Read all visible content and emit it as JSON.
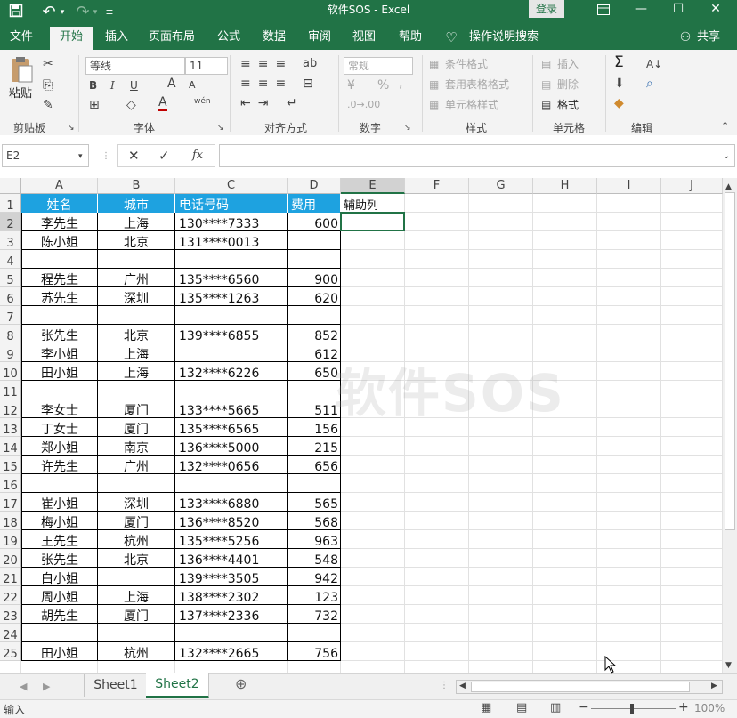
{
  "titlebar": {
    "title": "软件SOS  -  Excel",
    "login": "登录"
  },
  "tabs": [
    {
      "label": "文件"
    },
    {
      "label": "开始"
    },
    {
      "label": "插入"
    },
    {
      "label": "页面布局"
    },
    {
      "label": "公式"
    },
    {
      "label": "数据"
    },
    {
      "label": "审阅"
    },
    {
      "label": "视图"
    },
    {
      "label": "帮助"
    }
  ],
  "tellme": "操作说明搜索",
  "share": "共享",
  "ribbon": {
    "clipboard": {
      "paste": "粘贴",
      "label": "剪贴板"
    },
    "font": {
      "name": "等线",
      "size": "11",
      "label": "字体",
      "bold": "B",
      "italic": "I",
      "underline": "U",
      "grow": "A",
      "shrink": "A",
      "color_a": "A",
      "phonetic": "wén"
    },
    "alignment": {
      "label": "对齐方式"
    },
    "number": {
      "format": "常规",
      "label": "数字",
      "percent": "%",
      "comma": ","
    },
    "styles": {
      "cond": "条件格式",
      "table": "套用表格格式",
      "cell": "单元格样式",
      "label": "样式"
    },
    "cells": {
      "insert": "插入",
      "delete": "删除",
      "format": "格式",
      "label": "单元格"
    },
    "editing": {
      "label": "编辑"
    }
  },
  "formula": {
    "namebox": "E2",
    "value": "",
    "fx": "fx",
    "cancel": "✕",
    "enter": "✓"
  },
  "columns": [
    "A",
    "B",
    "C",
    "D",
    "E",
    "F",
    "G",
    "H",
    "I",
    "J"
  ],
  "headers": {
    "a": "姓名",
    "b": "城市",
    "c": "电话号码",
    "d": "费用",
    "e": "辅助列"
  },
  "rows": [
    {
      "n": "2",
      "a": "李先生",
      "b": "上海",
      "c": "130****7333",
      "d": "600"
    },
    {
      "n": "3",
      "a": "陈小姐",
      "b": "北京",
      "c": "131****0013",
      "d": ""
    },
    {
      "n": "4",
      "a": "",
      "b": "",
      "c": "",
      "d": ""
    },
    {
      "n": "5",
      "a": "程先生",
      "b": "广州",
      "c": "135****6560",
      "d": "900"
    },
    {
      "n": "6",
      "a": "苏先生",
      "b": "深圳",
      "c": "135****1263",
      "d": "620"
    },
    {
      "n": "7",
      "a": "",
      "b": "",
      "c": "",
      "d": ""
    },
    {
      "n": "8",
      "a": "张先生",
      "b": "北京",
      "c": "139****6855",
      "d": "852"
    },
    {
      "n": "9",
      "a": "李小姐",
      "b": "上海",
      "c": "",
      "d": "612"
    },
    {
      "n": "10",
      "a": "田小姐",
      "b": "上海",
      "c": "132****6226",
      "d": "650"
    },
    {
      "n": "11",
      "a": "",
      "b": "",
      "c": "",
      "d": ""
    },
    {
      "n": "12",
      "a": "李女士",
      "b": "厦门",
      "c": "133****5665",
      "d": "511"
    },
    {
      "n": "13",
      "a": "丁女士",
      "b": "厦门",
      "c": "135****6565",
      "d": "156"
    },
    {
      "n": "14",
      "a": "郑小姐",
      "b": "南京",
      "c": "136****5000",
      "d": "215"
    },
    {
      "n": "15",
      "a": "许先生",
      "b": "广州",
      "c": "132****0656",
      "d": "656"
    },
    {
      "n": "16",
      "a": "",
      "b": "",
      "c": "",
      "d": ""
    },
    {
      "n": "17",
      "a": "崔小姐",
      "b": "深圳",
      "c": "133****6880",
      "d": "565"
    },
    {
      "n": "18",
      "a": "梅小姐",
      "b": "厦门",
      "c": "136****8520",
      "d": "568"
    },
    {
      "n": "19",
      "a": "王先生",
      "b": "杭州",
      "c": "135****5256",
      "d": "963"
    },
    {
      "n": "20",
      "a": "张先生",
      "b": "北京",
      "c": "136****4401",
      "d": "548"
    },
    {
      "n": "21",
      "a": "白小姐",
      "b": "",
      "c": "139****3505",
      "d": "942"
    },
    {
      "n": "22",
      "a": "周小姐",
      "b": "上海",
      "c": "138****2302",
      "d": "123"
    },
    {
      "n": "23",
      "a": "胡先生",
      "b": "厦门",
      "c": "137****2336",
      "d": "732"
    },
    {
      "n": "24",
      "a": "",
      "b": "",
      "c": "",
      "d": ""
    },
    {
      "n": "25",
      "a": "田小姐",
      "b": "杭州",
      "c": "132****2665",
      "d": "756"
    }
  ],
  "sheets": [
    {
      "label": "Sheet1"
    },
    {
      "label": "Sheet2"
    }
  ],
  "status": {
    "mode": "输入",
    "zoom": "100%"
  },
  "watermark": "软件SOS",
  "colors": {
    "excel_green": "#217346",
    "header_fill": "#1ea2e0",
    "header_text": "#ffffff"
  }
}
